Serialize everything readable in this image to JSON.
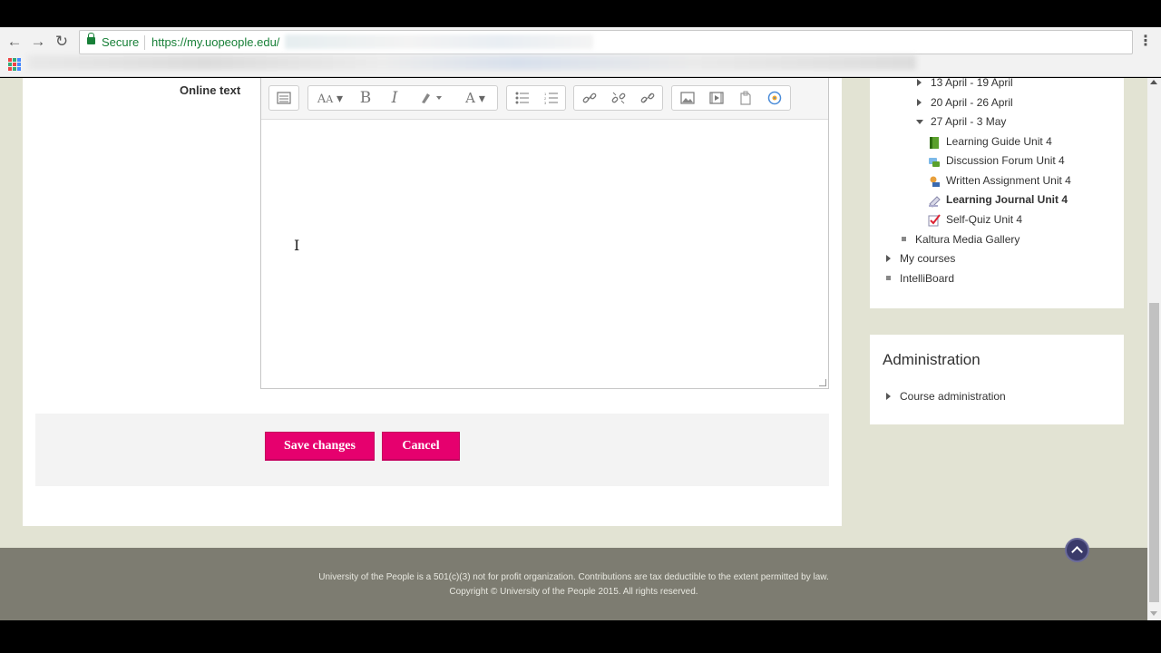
{
  "browser": {
    "secure_label": "Secure",
    "url": "https://my.uopeople.edu/",
    "back_icon": "arrow-left-icon",
    "forward_icon": "arrow-right-icon",
    "reload_icon": "reload-icon"
  },
  "form": {
    "online_text_label": "Online text",
    "save_label": "Save changes",
    "cancel_label": "Cancel",
    "button_color": "#e6006e"
  },
  "toolbar": {
    "groups": [
      [
        "toolbar-toggle-icon"
      ],
      [
        "font-size-icon",
        "bold-icon",
        "italic-icon",
        "styles-icon",
        "font-color-icon"
      ],
      [
        "unordered-list-icon",
        "ordered-list-icon"
      ],
      [
        "link-icon",
        "unlink-icon",
        "auto-link-icon"
      ],
      [
        "image-icon",
        "media-icon",
        "files-icon",
        "accessibility-icon"
      ]
    ],
    "bold_glyph": "B",
    "italic_glyph": "I"
  },
  "navigation": {
    "weeks": [
      "13 April - 19 April",
      "20 April - 26 April",
      "27 April - 3 May"
    ],
    "unit_items": [
      {
        "label": "Learning Guide Unit 4",
        "icon": "book-icon",
        "bold": false
      },
      {
        "label": "Discussion Forum Unit 4",
        "icon": "forum-icon",
        "bold": false
      },
      {
        "label": "Written Assignment Unit 4",
        "icon": "assignment-icon",
        "bold": false
      },
      {
        "label": "Learning Journal Unit 4",
        "icon": "journal-icon",
        "bold": true
      },
      {
        "label": "Self-Quiz Unit 4",
        "icon": "quiz-icon",
        "bold": false
      }
    ],
    "kaltura": "Kaltura Media Gallery",
    "my_courses": "My courses",
    "intelliboard": "IntelliBoard"
  },
  "administration": {
    "title": "Administration",
    "course_admin": "Course administration"
  },
  "footer": {
    "line1": "University of the People is a 501(c)(3) not for profit organization. Contributions are tax deductible to the extent permitted by law.",
    "line2": "Copyright © University of the People 2015. All rights reserved."
  }
}
